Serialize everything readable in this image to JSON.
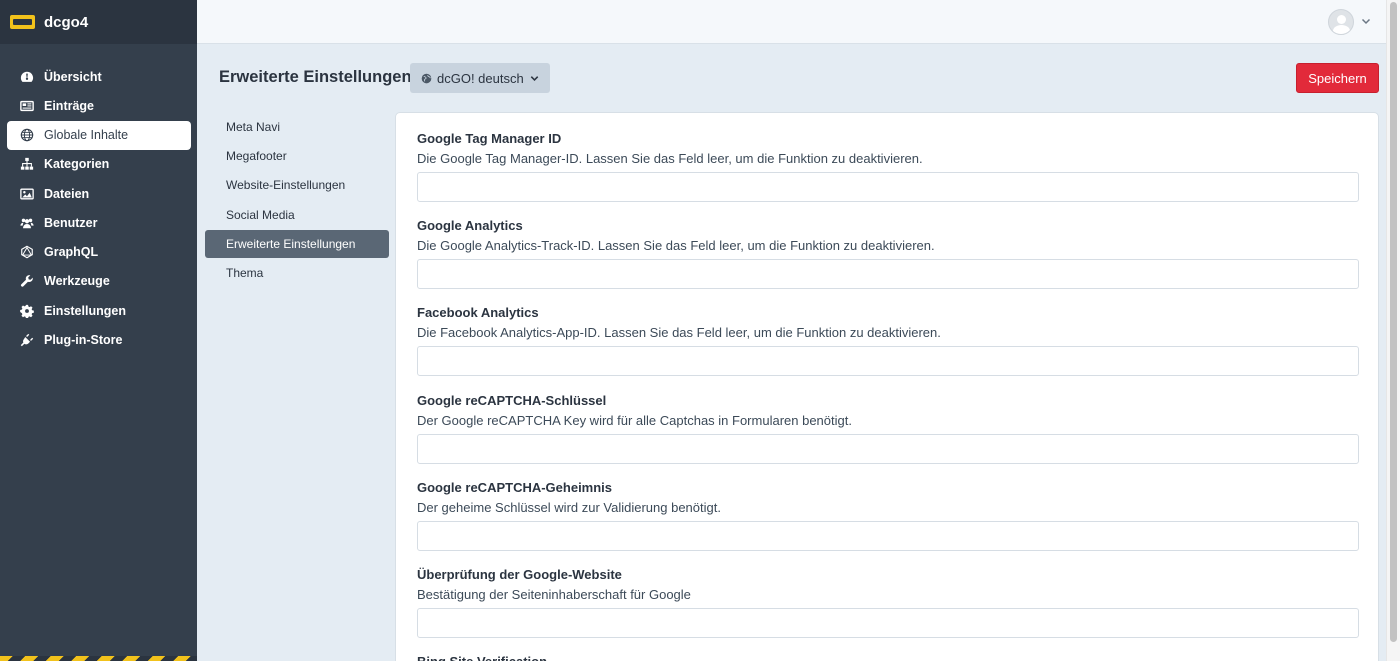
{
  "brand": {
    "name": "dcgo4"
  },
  "sidebar": {
    "items": [
      {
        "label": "Übersicht",
        "icon": "dashboard-icon"
      },
      {
        "label": "Einträge",
        "icon": "newspaper-icon"
      },
      {
        "label": "Globale Inhalte",
        "icon": "globe-icon",
        "active": true
      },
      {
        "label": "Kategorien",
        "icon": "sitemap-icon"
      },
      {
        "label": "Dateien",
        "icon": "image-icon"
      },
      {
        "label": "Benutzer",
        "icon": "users-icon"
      },
      {
        "label": "GraphQL",
        "icon": "graphql-icon"
      },
      {
        "label": "Werkzeuge",
        "icon": "wrench-icon"
      },
      {
        "label": "Einstellungen",
        "icon": "gear-icon"
      },
      {
        "label": "Plug-in-Store",
        "icon": "plug-icon"
      }
    ]
  },
  "header": {
    "title": "Erweiterte Einstellungen",
    "language": "dcGO! deutsch",
    "save_label": "Speichern"
  },
  "subnav": {
    "items": [
      {
        "label": "Meta Navi"
      },
      {
        "label": "Megafooter"
      },
      {
        "label": "Website-Einstellungen"
      },
      {
        "label": "Social Media"
      },
      {
        "label": "Erweiterte Einstellungen",
        "active": true
      },
      {
        "label": "Thema"
      }
    ]
  },
  "fields": [
    {
      "label": "Google Tag Manager ID",
      "help": "Die Google Tag Manager-ID. Lassen Sie das Feld leer, um die Funktion zu deaktivieren.",
      "value": ""
    },
    {
      "label": "Google Analytics",
      "help": "Die Google Analytics-Track-ID. Lassen Sie das Feld leer, um die Funktion zu deaktivieren.",
      "value": ""
    },
    {
      "label": "Facebook Analytics",
      "help": "Die Facebook Analytics-App-ID. Lassen Sie das Feld leer, um die Funktion zu deaktivieren.",
      "value": ""
    },
    {
      "label": "Google reCAPTCHA-Schlüssel",
      "help": "Der Google reCAPTCHA Key wird für alle Captchas in Formularen benötigt.",
      "value": ""
    },
    {
      "label": "Google reCAPTCHA-Geheimnis",
      "help": "Der geheime Schlüssel wird zur Validierung benötigt.",
      "value": ""
    },
    {
      "label": "Überprüfung der Google-Website",
      "help": "Bestätigung der Seiteninhaberschaft für Google",
      "value": ""
    },
    {
      "label": "Bing Site Verification",
      "help": "",
      "value": ""
    }
  ]
}
